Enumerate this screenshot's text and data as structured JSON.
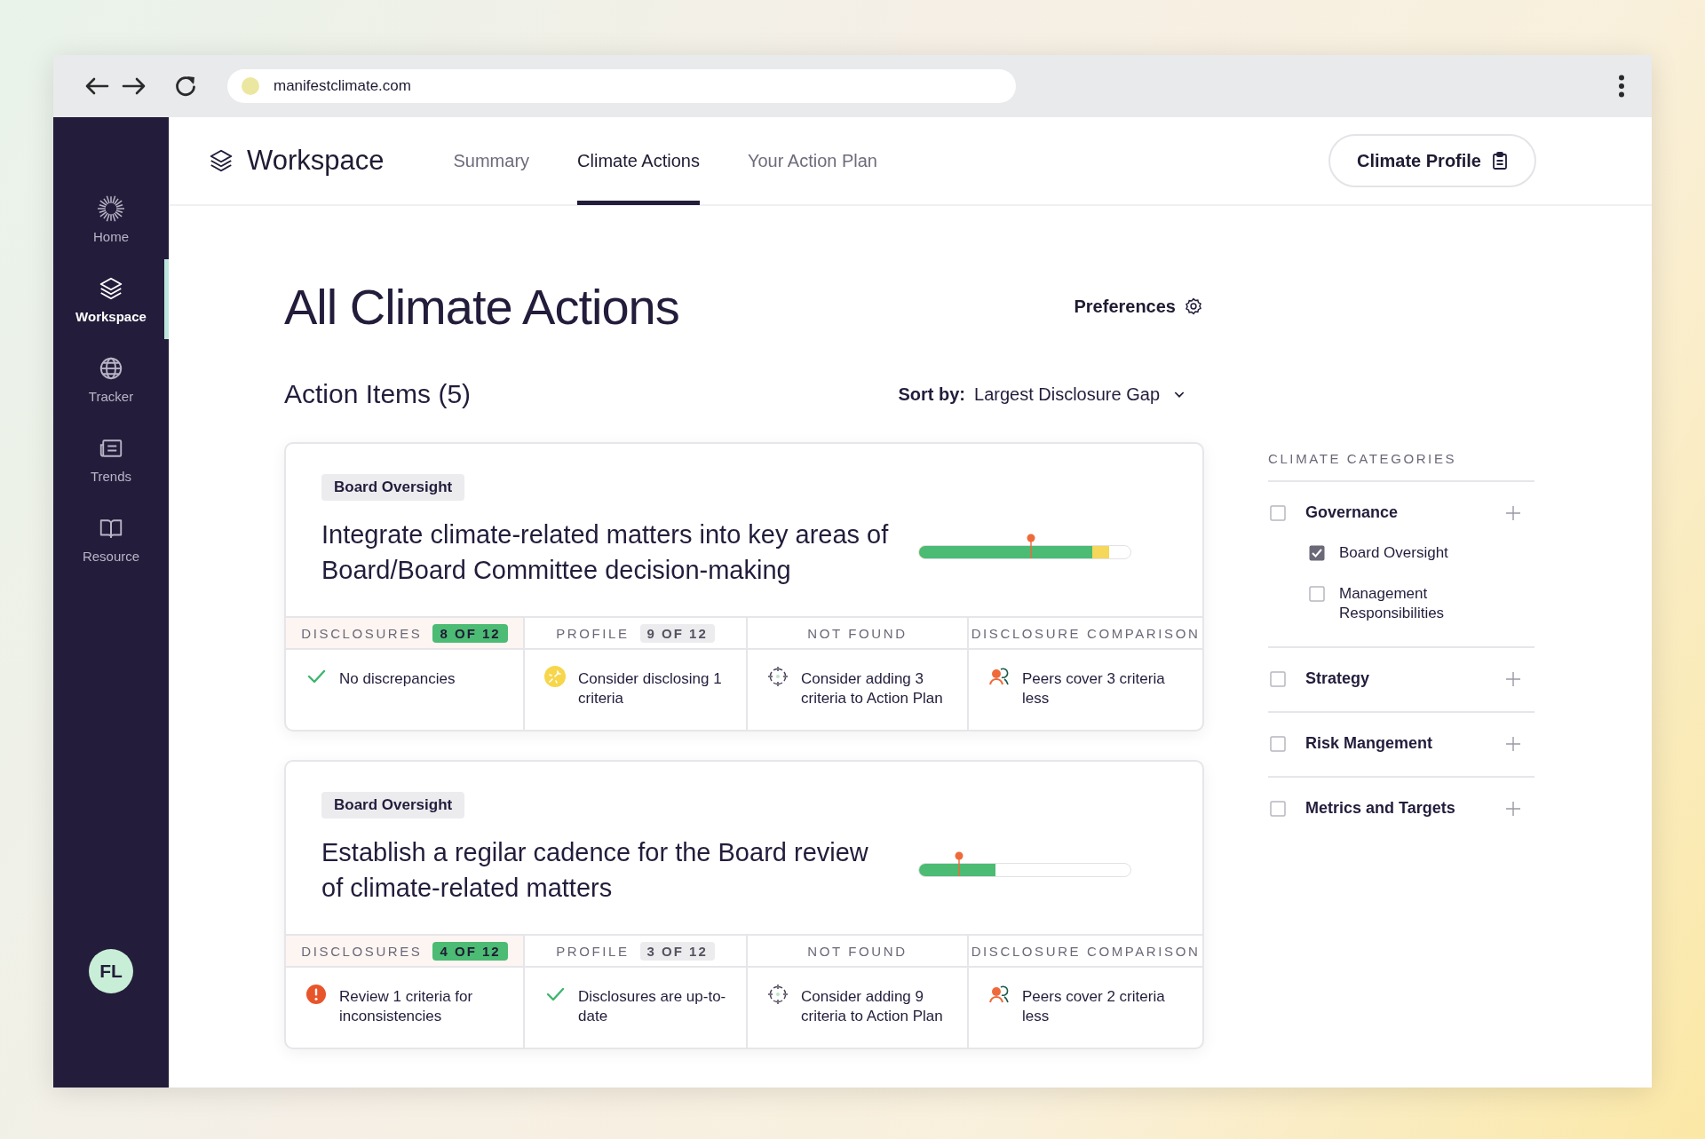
{
  "browser": {
    "url": "manifestclimate.com"
  },
  "sidebar": {
    "items": [
      {
        "label": "Home",
        "kind": "sunburst",
        "selected": false
      },
      {
        "label": "Workspace",
        "kind": "layers",
        "selected": true
      },
      {
        "label": "Tracker",
        "kind": "globe",
        "selected": false
      },
      {
        "label": "Trends",
        "kind": "news",
        "selected": false
      },
      {
        "label": "Resource",
        "kind": "book",
        "selected": false
      }
    ],
    "avatar": "FL"
  },
  "header": {
    "title": "Workspace",
    "tabs": [
      {
        "label": "Summary",
        "selected": false
      },
      {
        "label": "Climate Actions",
        "selected": true
      },
      {
        "label": "Your Action Plan",
        "selected": false
      }
    ],
    "button": "Climate Profile"
  },
  "page": {
    "title": "All Climate Actions",
    "preferences": "Preferences",
    "section": "Action Items (5)",
    "sort": {
      "label": "Sort by:",
      "value": "Largest Disclosure Gap"
    }
  },
  "cards": [
    {
      "tag": "Board Oversight",
      "title": "Integrate climate-related matters into key areas of Board/Board Committee decision-making",
      "bar": {
        "level": 0.82,
        "pending": {
          "level": 0.9
        },
        "marker": {
          "level": 0.53
        }
      },
      "columns": [
        {
          "label": "DISCLOSURES",
          "badge": "8 OF 12",
          "kind": "positive",
          "highlighted": true
        },
        {
          "label": "PROFILE",
          "badge": "9 OF 12",
          "kind": "neutral",
          "highlighted": false
        },
        {
          "label": "NOT FOUND",
          "highlighted": false
        },
        {
          "label": "DISCLOSURE COMPARISON",
          "highlighted": false
        }
      ],
      "cells": [
        {
          "kind": "check",
          "text": "No discrepancies"
        },
        {
          "kind": "sparkle",
          "text": "Consider disclosing 1 criteria"
        },
        {
          "kind": "target",
          "text": "Consider adding 3 criteria to Action Plan"
        },
        {
          "kind": "peers",
          "text": "Peers cover 3 criteria less"
        }
      ]
    },
    {
      "tag": "Board Oversight",
      "title": "Establish a regilar cadence for the Board review of climate-related matters",
      "bar": {
        "level": 0.36,
        "marker": {
          "level": 0.19
        }
      },
      "columns": [
        {
          "label": "DISCLOSURES",
          "badge": "4 OF 12",
          "kind": "positive",
          "highlighted": true
        },
        {
          "label": "PROFILE",
          "badge": "3 OF 12",
          "kind": "neutral",
          "highlighted": false
        },
        {
          "label": "NOT FOUND",
          "highlighted": false
        },
        {
          "label": "DISCLOSURE COMPARISON",
          "highlighted": false
        }
      ],
      "cells": [
        {
          "kind": "alert",
          "text": "Review 1 criteria for inconsistencies"
        },
        {
          "kind": "check",
          "text": "Disclosures are up-to-date"
        },
        {
          "kind": "target",
          "text": "Consider adding 9 criteria to Action Plan"
        },
        {
          "kind": "peers",
          "text": "Peers cover 2 criteria less"
        }
      ]
    }
  ],
  "categories": {
    "title": "CLIMATE CATEGORIES",
    "groups": [
      {
        "label": "Governance",
        "checked": false,
        "children": [
          {
            "label": "Board Oversight",
            "checked": true
          },
          {
            "label": "Management Responsibilities",
            "checked": false
          }
        ]
      },
      {
        "label": "Strategy",
        "checked": false
      },
      {
        "label": "Risk Mangement",
        "checked": false
      },
      {
        "label": "Metrics and Targets",
        "checked": false
      }
    ]
  }
}
